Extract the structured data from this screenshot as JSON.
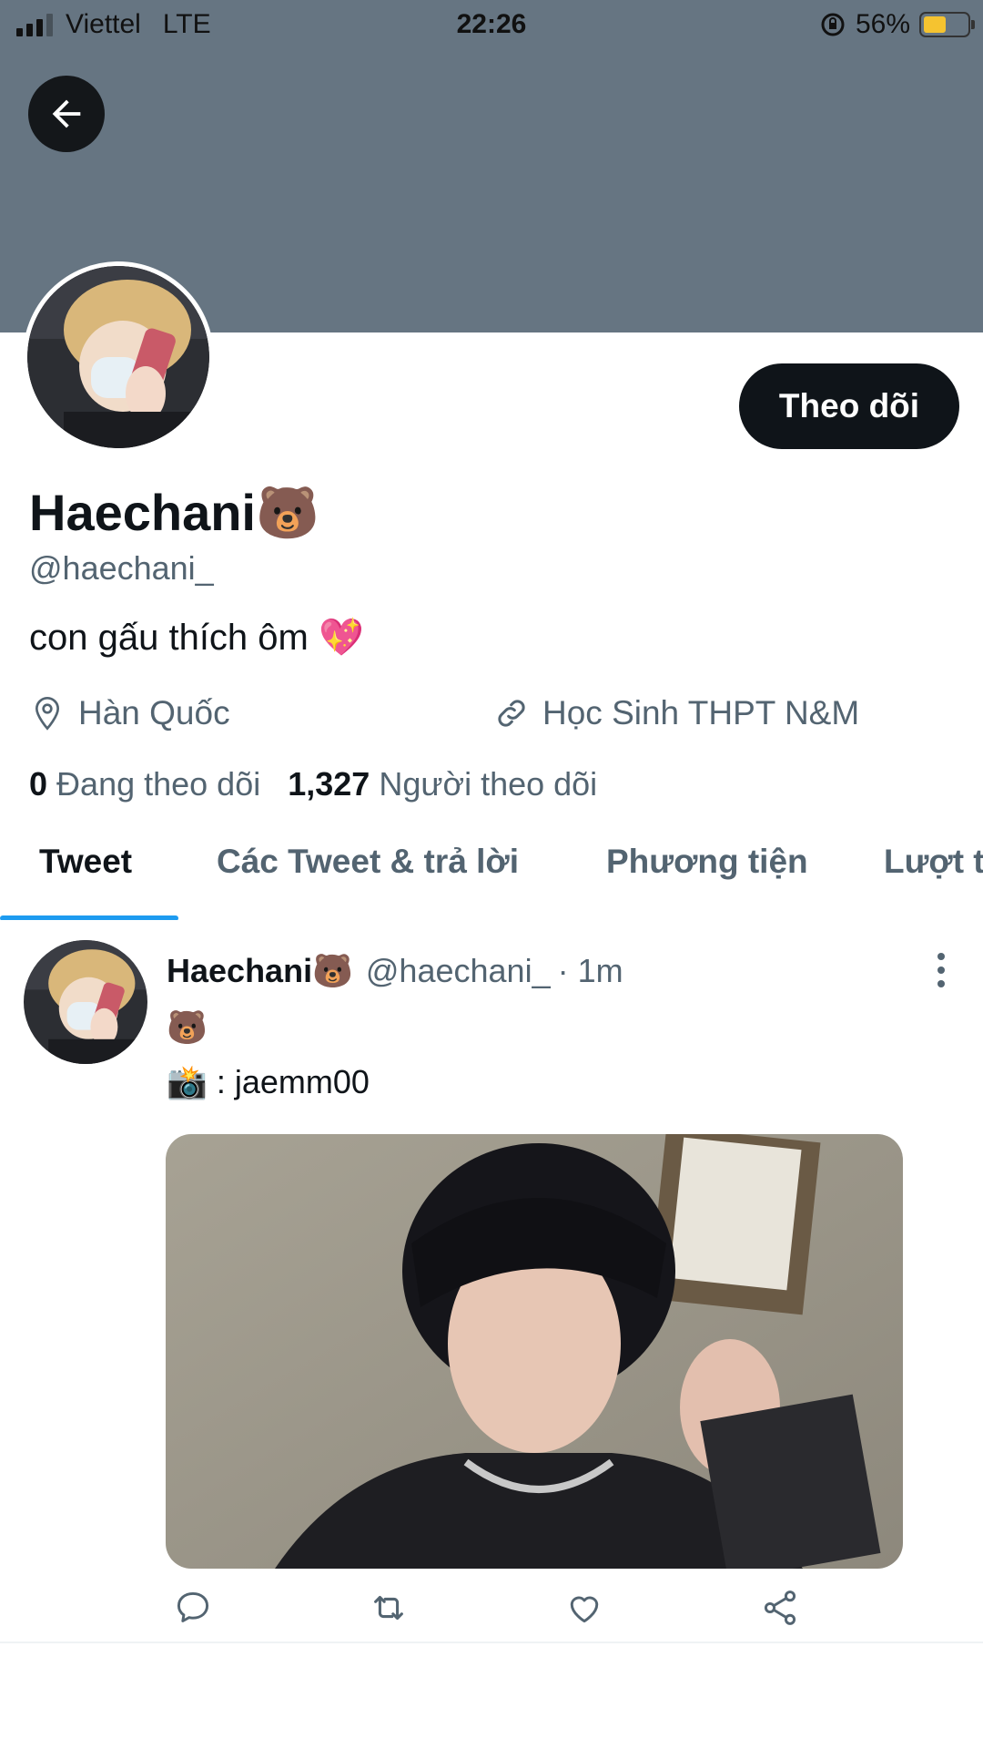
{
  "status_bar": {
    "carrier": "Viettel",
    "network": "LTE",
    "time": "22:26",
    "battery_percent": "56%",
    "battery_level": 0.56,
    "battery_color": "#f5c330"
  },
  "header": {
    "banner_color": "#667582",
    "back_icon": "arrow-left-icon"
  },
  "profile": {
    "display_name": "Haechani🐻",
    "handle": "@haechani_",
    "bio": "con gấu thích ôm 💖",
    "location": "Hàn Quốc",
    "link": "Học Sinh THPT N&M",
    "following_count": "0",
    "following_label": "Đang theo dõi",
    "followers_count": "1,327",
    "followers_label": "Người theo dõi",
    "follow_button_label": "Theo dõi"
  },
  "tabs": [
    {
      "label": "Tweet",
      "active": true
    },
    {
      "label": "Các Tweet & trả lời",
      "active": false
    },
    {
      "label": "Phương tiện",
      "active": false
    },
    {
      "label": "Lượt t",
      "active": false
    }
  ],
  "tweet": {
    "display_name": "Haechani🐻",
    "handle": "@haechani_",
    "time": "· 1m",
    "line1": "🐻",
    "line2": "📸 : jaemm00",
    "actions": [
      "reply-icon",
      "retweet-icon",
      "like-icon",
      "share-icon"
    ]
  },
  "colors": {
    "accent": "#1d9bf0",
    "text_primary": "#0f1419",
    "text_secondary": "#536471"
  }
}
